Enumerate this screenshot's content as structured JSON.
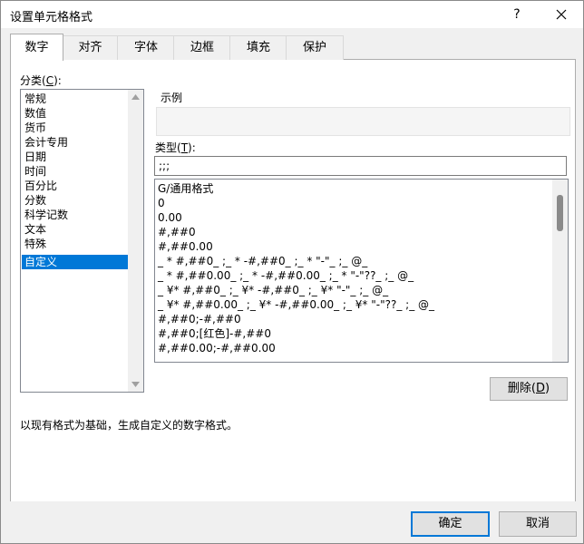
{
  "window": {
    "title": "设置单元格格式",
    "help_label": "?"
  },
  "tabs": [
    {
      "label": "数字",
      "active": true
    },
    {
      "label": "对齐",
      "active": false
    },
    {
      "label": "字体",
      "active": false
    },
    {
      "label": "边框",
      "active": false
    },
    {
      "label": "填充",
      "active": false
    },
    {
      "label": "保护",
      "active": false
    }
  ],
  "category": {
    "label": "分类(",
    "accel": "C",
    "label_end": "):",
    "items": [
      "常规",
      "数值",
      "货币",
      "会计专用",
      "日期",
      "时间",
      "百分比",
      "分数",
      "科学记数",
      "文本",
      "特殊",
      "自定义"
    ],
    "selected": "自定义"
  },
  "sample": {
    "label": "示例",
    "value": ""
  },
  "type": {
    "label": "类型(",
    "accel": "T",
    "label_end": "):",
    "value": ";;;"
  },
  "formats": [
    "G/通用格式",
    "0",
    "0.00",
    "#,##0",
    "#,##0.00",
    "_ * #,##0_ ;_ * -#,##0_ ;_ * \"-\"_ ;_ @_",
    "_ * #,##0.00_ ;_ * -#,##0.00_ ;_ * \"-\"??_ ;_ @_",
    "_ ¥* #,##0_ ;_ ¥* -#,##0_ ;_ ¥* \"-\"_ ;_ @_",
    "_ ¥* #,##0.00_ ;_ ¥* -#,##0.00_ ;_ ¥* \"-\"??_ ;_ @_",
    "#,##0;-#,##0",
    "#,##0;[红色]-#,##0",
    "#,##0.00;-#,##0.00"
  ],
  "buttons": {
    "delete": "删除(",
    "delete_accel": "D",
    "delete_end": ")",
    "ok": "确定",
    "cancel": "取消"
  },
  "description": "以现有格式为基础，生成自定义的数字格式。",
  "colors": {
    "selection": "#0078d7",
    "dialog_bg": "#f0f0f0"
  }
}
